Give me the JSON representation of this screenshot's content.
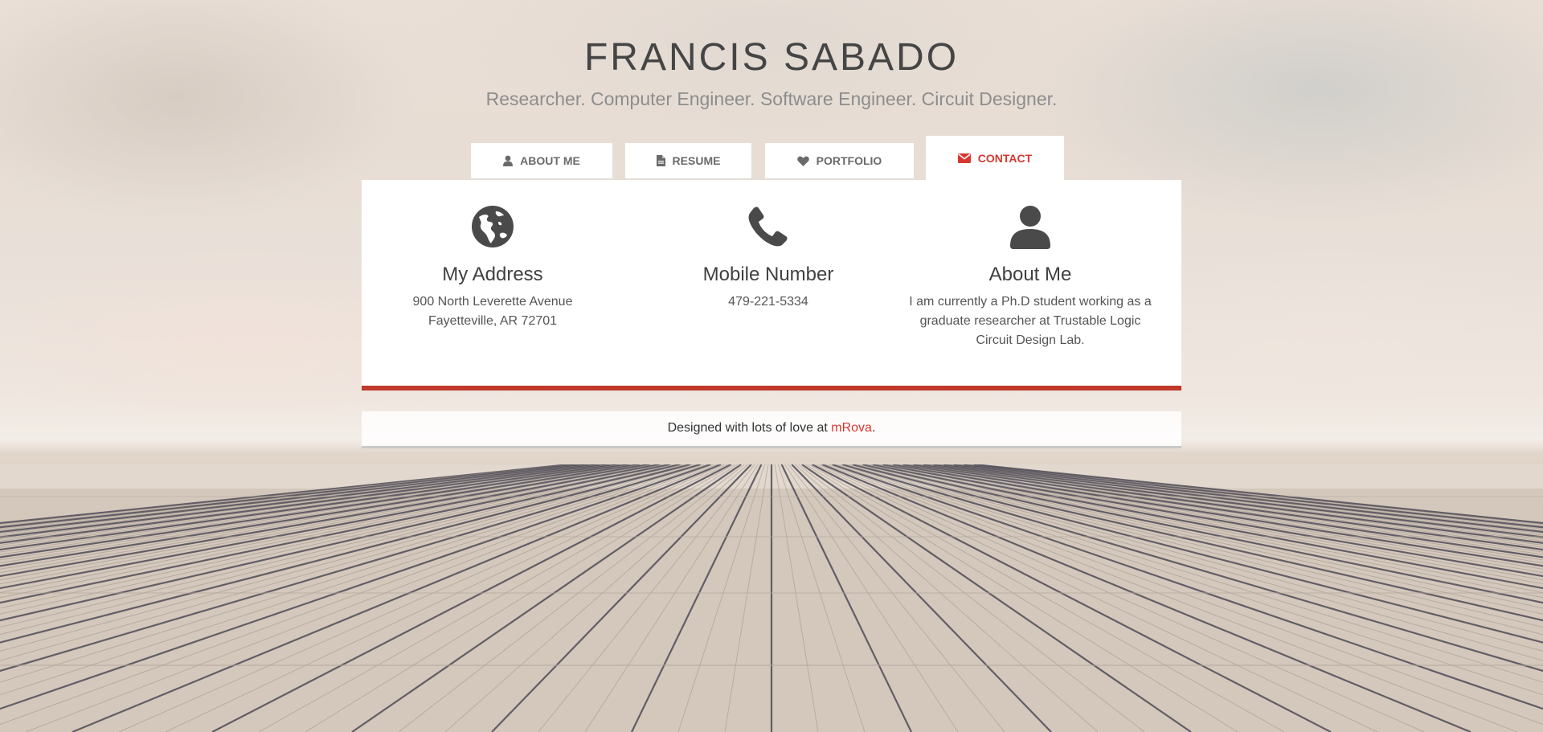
{
  "header": {
    "name": "FRANCIS SABADO",
    "tagline": "Researcher. Computer Engineer. Software Engineer. Circuit Designer."
  },
  "tabs": [
    {
      "label": "ABOUT ME",
      "icon": "user-icon",
      "active": false
    },
    {
      "label": "RESUME",
      "icon": "file-icon",
      "active": false
    },
    {
      "label": "PORTFOLIO",
      "icon": "heart-icon",
      "active": false
    },
    {
      "label": "CONTACT",
      "icon": "envelope-icon",
      "active": true
    }
  ],
  "contact": {
    "address": {
      "icon": "globe-icon",
      "heading": "My Address",
      "line1": "900 North Leverette Avenue",
      "line2": "Fayetteville, AR 72701"
    },
    "mobile": {
      "icon": "phone-icon",
      "heading": "Mobile Number",
      "number": "479-221-5334"
    },
    "about": {
      "icon": "user-icon",
      "heading": "About Me",
      "line1": "I am currently a Ph.D student working as a",
      "line2": "graduate researcher at Trustable Logic",
      "line3": "Circuit Design Lab."
    }
  },
  "footer": {
    "text": "Designed with lots of love at",
    "link": "mRova",
    "period": "."
  },
  "colors": {
    "accent": "#d6372f",
    "card_border": "#c0392b",
    "icon": "#4a4a4a",
    "title": "#454545",
    "subtitle": "#8d8d8d"
  }
}
